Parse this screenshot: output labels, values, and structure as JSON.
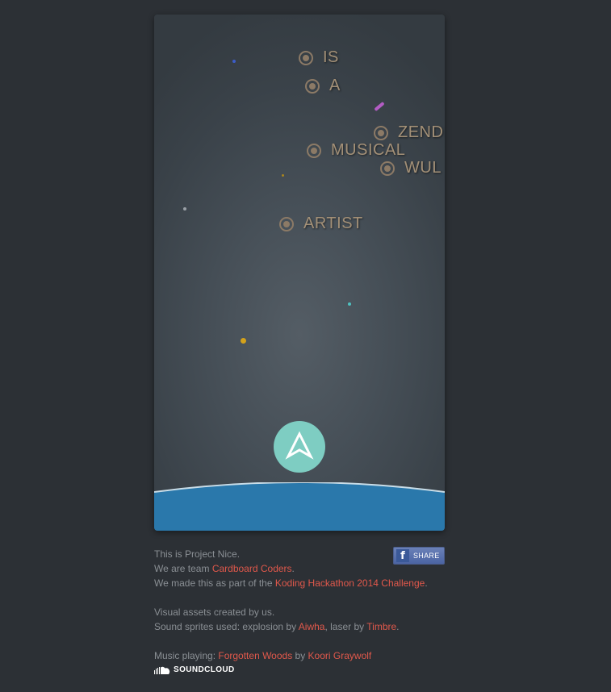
{
  "game": {
    "words": [
      {
        "text": "IS"
      },
      {
        "text": "A"
      },
      {
        "text": "ZENDI"
      },
      {
        "text": "MUSICAL"
      },
      {
        "text": "WUL"
      },
      {
        "text": "ARTIST"
      }
    ],
    "colors": {
      "ship": "#7ecdc2",
      "water": "#2a78ab",
      "water_rim": "#c9dde8",
      "target": "#8c7a66",
      "word": "#a39077"
    }
  },
  "footer": {
    "line1": "This is Project Nice.",
    "line2_prefix": "We are team ",
    "team_link": "Cardboard Coders",
    "line2_suffix": ".",
    "line3_prefix": "We made this as part of the ",
    "hackathon_link": "Koding Hackathon 2014 Challenge",
    "line3_suffix": ".",
    "line4": "Visual assets created by us.",
    "line5_prefix": "Sound sprites used: explosion by ",
    "aiwha_link": "Aiwha",
    "line5_mid": ", laser by ",
    "timbre_link": "Timbre",
    "line5_suffix": ".",
    "music_prefix": "Music playing: ",
    "track_link": "Forgotten Woods",
    "music_by": " by ",
    "artist_link": "Koori Graywolf",
    "soundcloud_label": "SOUNDCLOUD",
    "share_label": "SHARE",
    "share_logo": "f"
  }
}
